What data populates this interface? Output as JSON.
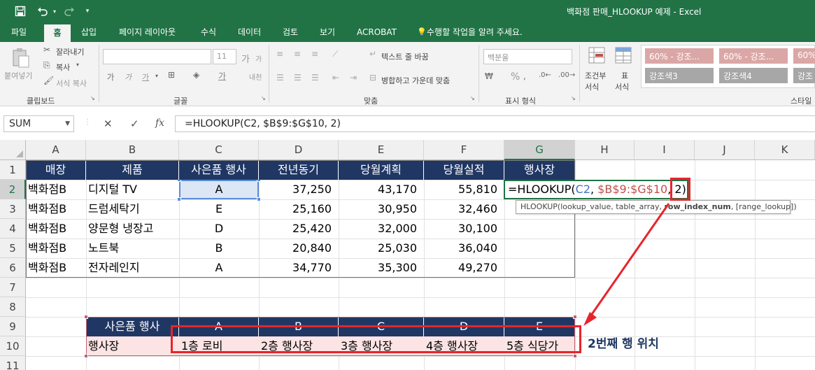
{
  "window": {
    "title": "백화점 판매_HLOOKUP 예제 - Excel",
    "qat_icons": [
      "save-icon",
      "undo-icon",
      "redo-icon",
      "customize-qat-icon"
    ]
  },
  "tabs": [
    "파일",
    "홈",
    "삽입",
    "페이지 레이아웃",
    "수식",
    "데이터",
    "검토",
    "보기",
    "ACROBAT",
    "수행할 작업을 알려 주세요."
  ],
  "active_tab": "홈",
  "ribbon": {
    "clipboard": {
      "paste": "붙여넣기",
      "cut": "잘라내기",
      "copy": "복사",
      "format_painter": "서식 복사",
      "label": "클립보드"
    },
    "font": {
      "font_size": "11",
      "bold": "가",
      "italic": "가",
      "underline": "가",
      "grow": "가",
      "shrink": "가",
      "phonetic": "내천",
      "label": "글꼴"
    },
    "alignment": {
      "wrap_text": "텍스트 줄 바꿈",
      "merge_center": "병합하고 가운데 맞춤",
      "label": "맞춤"
    },
    "number": {
      "format": "백분율",
      "percent": "%",
      "label": "표시 형식"
    },
    "styles": {
      "conditional": [
        "조건부",
        "서식"
      ],
      "as_table": [
        "표",
        "서식"
      ],
      "style_boxes": [
        "60% - 강조...",
        "60% - 강조...",
        "60%",
        "강조색3",
        "강조색4",
        "강조"
      ],
      "label": "스타일"
    }
  },
  "formula_bar": {
    "name_box": "SUM",
    "cancel": "✕",
    "enter": "✓",
    "fx": "fx",
    "formula": "=HLOOKUP(C2, $B$9:$G$10, 2)"
  },
  "columns": [
    "A",
    "B",
    "C",
    "D",
    "E",
    "F",
    "G",
    "H",
    "I",
    "J",
    "K"
  ],
  "rows": [
    "1",
    "2",
    "3",
    "4",
    "5",
    "6",
    "7",
    "8",
    "9",
    "10",
    "11"
  ],
  "table1": {
    "headers": [
      "매장",
      "제품",
      "사은품 행사",
      "전년동기",
      "당월계획",
      "당월실적",
      "행사장"
    ],
    "rows": [
      [
        "백화점B",
        "디지털 TV",
        "A",
        "37,250",
        "43,170",
        "55,810"
      ],
      [
        "백화점B",
        "드럼세탁기",
        "E",
        "25,160",
        "30,950",
        "32,460"
      ],
      [
        "백화점B",
        "양문형 냉장고",
        "D",
        "25,420",
        "32,000",
        "30,100"
      ],
      [
        "백화점B",
        "노트북",
        "B",
        "20,840",
        "25,030",
        "36,040"
      ],
      [
        "백화점B",
        "전자레인지",
        "A",
        "34,770",
        "35,300",
        "49,270"
      ]
    ]
  },
  "editing_cell": {
    "prefix": "=HLOOKUP(",
    "arg1": "C2",
    "sep1": ", ",
    "arg2": "$B$9:$G$10",
    "sep2": ", ",
    "arg3": "2",
    "suffix": ")",
    "arg1_color": "#4472c4",
    "arg2_color": "#c0504d"
  },
  "tooltip": {
    "before": "HLOOKUP(lookup_value, table_array, ",
    "bold": "row_index_num",
    "after": ", [range_lookup])"
  },
  "table2": {
    "headers": [
      "사은품 행사",
      "A",
      "B",
      "C",
      "D",
      "E"
    ],
    "values": [
      "행사장",
      "1층 로비",
      "2층 행사장",
      "3층 행사장",
      "4층 행사장",
      "5층 식당가"
    ]
  },
  "annotation": "2번째 행 위치",
  "colors": {
    "excel_green": "#217346",
    "table_header": "#203764",
    "pink_fill": "#fce4e4",
    "highlight_red": "#e5252b",
    "selection_blue": "#dce6f5"
  }
}
